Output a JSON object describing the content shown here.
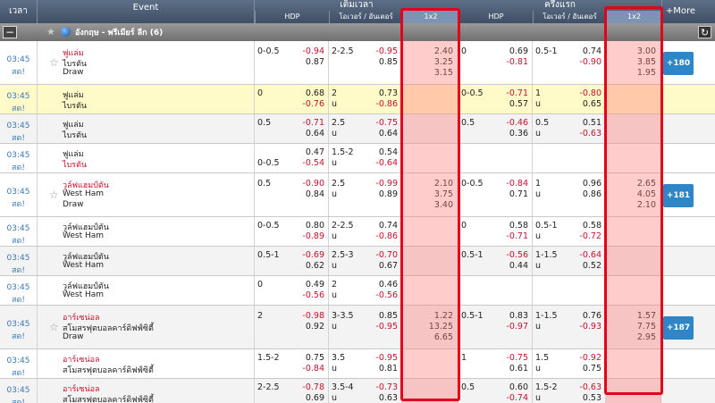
{
  "header": {
    "time": "เวลา",
    "event": "Event",
    "full_time": "เต็มเวลา",
    "first_half": "ครึ่งแรก",
    "hdp": "HDP",
    "ou": "โอเวอร์ / อันเดอร์",
    "x12": "1x2",
    "more": "+More"
  },
  "league": {
    "collapse": "−",
    "name": "อังกฤษ - พรีเมียร์ ลีก (6)",
    "refresh": "↻"
  },
  "rows": [
    {
      "t1": "03:45",
      "t2": "สด!",
      "home": "ฟูแล่ม",
      "away": "ไบรตัน",
      "draw": "Draw",
      "home_red": true,
      "away_red": false,
      "star": true,
      "hdp_line": "0-0.5",
      "hdp_line_row": "top",
      "hdp_h": "-0.94",
      "hdp_a": "0.87",
      "ou_line": "2-2.5",
      "ou_u": "",
      "ou_o": "-0.95",
      "ou_un": "0.85",
      "x1": [
        "2.40",
        "3.25",
        "3.15"
      ],
      "fh_hdp_line": "0",
      "fh_hdp_line_row": "top",
      "fh_hdp_h": "0.69",
      "fh_hdp_a": "-0.81",
      "fh_ou_line": "0.5-1",
      "fh_ou_u": "",
      "fh_ou_o": "0.74",
      "fh_ou_un": "-0.90",
      "x2": [
        "3.00",
        "3.85",
        "1.95"
      ],
      "more": "+180"
    },
    {
      "t1": "03:45",
      "t2": "สด!",
      "home": "ฟูแล่ม",
      "away": "ไบรตัน",
      "home_red": false,
      "away_red": false,
      "hdp_line": "0",
      "hdp_line_row": "top",
      "hdp_h": "0.68",
      "hdp_a": "-0.76",
      "ou_line": "2",
      "ou_u": "u",
      "ou_o": "0.73",
      "ou_un": "-0.86",
      "fh_hdp_line": "0-0.5",
      "fh_hdp_line_row": "top",
      "fh_hdp_h": "-0.71",
      "fh_hdp_a": "0.57",
      "fh_ou_line": "1",
      "fh_ou_u": "u",
      "fh_ou_o": "-0.80",
      "fh_ou_un": "0.65"
    },
    {
      "t1": "03:45",
      "t2": "สด!",
      "home": "ฟูแล่ม",
      "away": "ไบรตัน",
      "home_red": false,
      "away_red": false,
      "hdp_line": "0.5",
      "hdp_line_row": "top",
      "hdp_h": "-0.71",
      "hdp_a": "0.64",
      "ou_line": "2.5",
      "ou_u": "u",
      "ou_o": "-0.75",
      "ou_un": "0.64",
      "fh_hdp_line": "0.5",
      "fh_hdp_line_row": "top",
      "fh_hdp_h": "-0.46",
      "fh_hdp_a": "0.36",
      "fh_ou_line": "0.5",
      "fh_ou_u": "u",
      "fh_ou_o": "0.51",
      "fh_ou_un": "-0.63"
    },
    {
      "t1": "03:45",
      "t2": "สด!",
      "home": "ฟูแล่ม",
      "away": "ไบรตัน",
      "home_red": false,
      "away_red": true,
      "hdp_line": "0-0.5",
      "hdp_line_row": "bottom",
      "hdp_h": "0.47",
      "hdp_a": "-0.54",
      "ou_line": "1.5-2",
      "ou_u": "u",
      "ou_o": "0.54",
      "ou_un": "-0.64",
      "fh_hdp_line": "",
      "fh_hdp_line_row": "top",
      "fh_hdp_h": "",
      "fh_hdp_a": "",
      "fh_ou_line": "",
      "fh_ou_u": "",
      "fh_ou_o": "",
      "fh_ou_un": ""
    },
    {
      "t1": "03:45",
      "t2": "สด!",
      "home": "วูล์ฟแฮมป์ตัน",
      "away": "West Ham",
      "draw": "Draw",
      "home_red": true,
      "away_red": false,
      "star": true,
      "hdp_line": "0.5",
      "hdp_line_row": "top",
      "hdp_h": "-0.90",
      "hdp_a": "0.84",
      "ou_line": "2.5",
      "ou_u": "u",
      "ou_o": "-0.99",
      "ou_un": "0.89",
      "x1": [
        "2.10",
        "3.75",
        "3.40"
      ],
      "fh_hdp_line": "0-0.5",
      "fh_hdp_line_row": "top",
      "fh_hdp_h": "-0.84",
      "fh_hdp_a": "0.71",
      "fh_ou_line": "1",
      "fh_ou_u": "u",
      "fh_ou_o": "0.96",
      "fh_ou_un": "0.86",
      "x2": [
        "2.65",
        "4.05",
        "2.10"
      ],
      "more": "+181"
    },
    {
      "t1": "03:45",
      "t2": "สด!",
      "home": "วูล์ฟแฮมป์ตัน",
      "away": "West Ham",
      "home_red": false,
      "away_red": false,
      "hdp_line": "0-0.5",
      "hdp_line_row": "top",
      "hdp_h": "0.80",
      "hdp_a": "-0.89",
      "ou_line": "2-2.5",
      "ou_u": "u",
      "ou_o": "0.74",
      "ou_un": "-0.86",
      "fh_hdp_line": "0",
      "fh_hdp_line_row": "top",
      "fh_hdp_h": "0.58",
      "fh_hdp_a": "-0.71",
      "fh_ou_line": "0.5-1",
      "fh_ou_u": "u",
      "fh_ou_o": "0.58",
      "fh_ou_un": "-0.72"
    },
    {
      "t1": "03:45",
      "t2": "สด!",
      "home": "วูล์ฟแฮมป์ตัน",
      "away": "West Ham",
      "home_red": false,
      "away_red": false,
      "hdp_line": "0.5-1",
      "hdp_line_row": "top",
      "hdp_h": "-0.69",
      "hdp_a": "0.62",
      "ou_line": "2.5-3",
      "ou_u": "u",
      "ou_o": "-0.70",
      "ou_un": "0.67",
      "fh_hdp_line": "0.5-1",
      "fh_hdp_line_row": "top",
      "fh_hdp_h": "-0.56",
      "fh_hdp_a": "0.44",
      "fh_ou_line": "1-1.5",
      "fh_ou_u": "u",
      "fh_ou_o": "-0.64",
      "fh_ou_un": "0.52"
    },
    {
      "t1": "03:45",
      "t2": "สด!",
      "home": "วูล์ฟแฮมป์ตัน",
      "away": "West Ham",
      "home_red": false,
      "away_red": false,
      "hdp_line": "0",
      "hdp_line_row": "top",
      "hdp_h": "0.49",
      "hdp_a": "-0.56",
      "ou_line": "2",
      "ou_u": "u",
      "ou_o": "0.46",
      "ou_un": "-0.56",
      "fh_hdp_line": "",
      "fh_hdp_line_row": "top",
      "fh_hdp_h": "",
      "fh_hdp_a": "",
      "fh_ou_line": "",
      "fh_ou_u": "",
      "fh_ou_o": "",
      "fh_ou_un": ""
    },
    {
      "t1": "03:45",
      "t2": "สด!",
      "home": "อาร์เซน่อล",
      "away": "สโมสรฟุตบอลคาร์ดิฟฟ์ซิตี้",
      "draw": "Draw",
      "home_red": true,
      "away_red": false,
      "star": true,
      "hdp_line": "2",
      "hdp_line_row": "top",
      "hdp_h": "-0.98",
      "hdp_a": "0.92",
      "ou_line": "3-3.5",
      "ou_u": "u",
      "ou_o": "0.85",
      "ou_un": "-0.95",
      "x1": [
        "1.22",
        "13.25",
        "6.65"
      ],
      "fh_hdp_line": "0.5-1",
      "fh_hdp_line_row": "top",
      "fh_hdp_h": "0.83",
      "fh_hdp_a": "-0.97",
      "fh_ou_line": "1-1.5",
      "fh_ou_u": "u",
      "fh_ou_o": "0.76",
      "fh_ou_un": "-0.93",
      "x2": [
        "1.57",
        "7.75",
        "2.95"
      ],
      "more": "+187"
    },
    {
      "t1": "03:45",
      "t2": "สด!",
      "home": "อาร์เซน่อล",
      "away": "สโมสรฟุตบอลคาร์ดิฟฟ์ซิตี้",
      "home_red": true,
      "away_red": false,
      "hdp_line": "1.5-2",
      "hdp_line_row": "top",
      "hdp_h": "0.75",
      "hdp_a": "-0.84",
      "ou_line": "3.5",
      "ou_u": "u",
      "ou_o": "-0.95",
      "ou_un": "0.81",
      "fh_hdp_line": "1",
      "fh_hdp_line_row": "top",
      "fh_hdp_h": "-0.75",
      "fh_hdp_a": "0.61",
      "fh_ou_line": "1.5",
      "fh_ou_u": "u",
      "fh_ou_o": "-0.92",
      "fh_ou_un": "0.75"
    },
    {
      "t1": "03:45",
      "t2": "สด!",
      "home": "อาร์เซน่อล",
      "away": "สโมสรฟุตบอลคาร์ดิฟฟ์ซิตี้",
      "home_red": true,
      "away_red": false,
      "hdp_line": "2-2.5",
      "hdp_line_row": "top",
      "hdp_h": "-0.78",
      "hdp_a": "0.69",
      "ou_line": "3.5-4",
      "ou_u": "u",
      "ou_o": "-0.73",
      "ou_un": "0.63",
      "fh_hdp_line": "0.5",
      "fh_hdp_line_row": "top",
      "fh_hdp_h": "0.60",
      "fh_hdp_a": "-0.74",
      "fh_ou_line": "1.5-2",
      "fh_ou_u": "u",
      "fh_ou_o": "-0.63",
      "fh_ou_un": "0.53"
    }
  ],
  "colors": {
    "highlight_frame": "#e3001b",
    "header_bg": "#4e6079",
    "more_button": "#2f86c7",
    "team_red": "#c8102e",
    "time_blue": "#3a78b8"
  },
  "icons": [
    "star-icon",
    "globe-icon",
    "collapse-icon",
    "refresh-icon"
  ]
}
